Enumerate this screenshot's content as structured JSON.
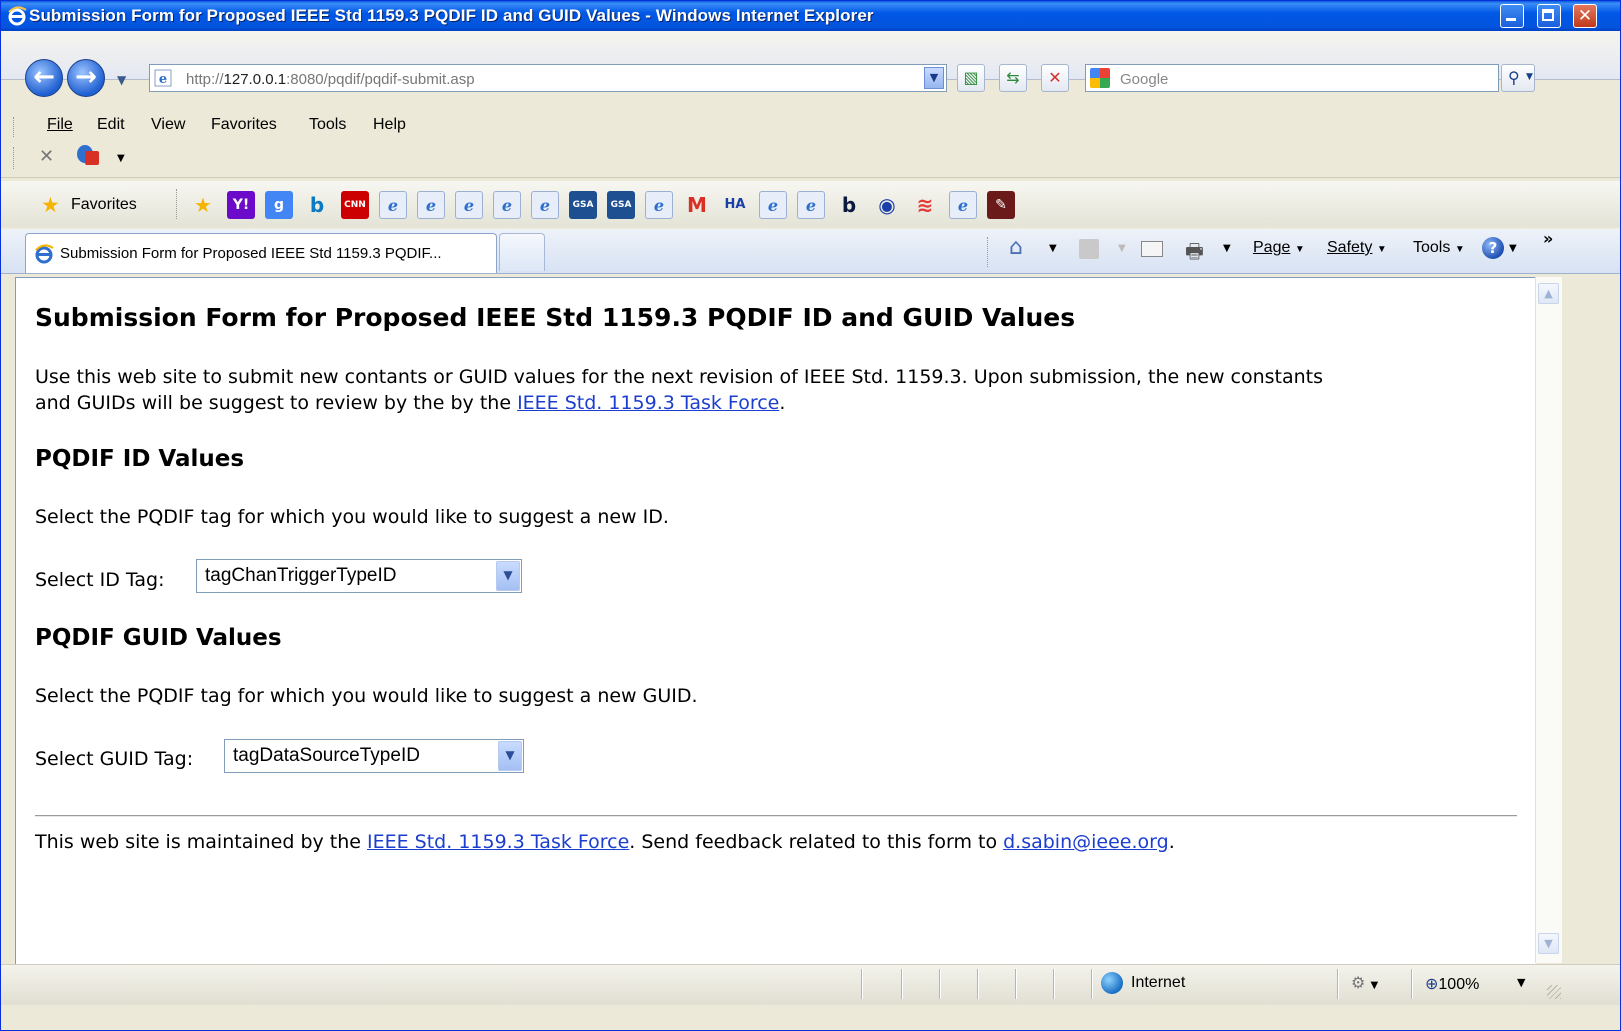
{
  "window": {
    "title": "Submission Form for Proposed IEEE Std 1159.3 PQDIF ID and GUID Values - Windows Internet Explorer"
  },
  "address": {
    "url_prefix": "http://",
    "url_host": "127.0.0.1",
    "url_rest": ":8080/pqdif/pqdif-submit.asp"
  },
  "search": {
    "placeholder": "Google"
  },
  "menu": {
    "file": "File",
    "edit": "Edit",
    "view": "View",
    "favorites": "Favorites",
    "tools": "Tools",
    "help": "Help"
  },
  "favorites_bar": {
    "label": "Favorites",
    "icons": [
      {
        "name": "add-favorite-icon",
        "text": "★",
        "color": "#f4b400"
      },
      {
        "name": "yahoo-icon",
        "text": "Y!",
        "color": "#6b0ac9"
      },
      {
        "name": "google-icon",
        "text": "g",
        "color": "#4285f4"
      },
      {
        "name": "bing-icon",
        "text": "b",
        "color": "#0a7ac4"
      },
      {
        "name": "cnn-icon",
        "text": "CNN",
        "color": "#cc0000"
      },
      {
        "name": "ie-page-icon",
        "text": "e",
        "color": "#2f6fce"
      },
      {
        "name": "ie-page-icon",
        "text": "e",
        "color": "#2f6fce"
      },
      {
        "name": "ie-page-icon",
        "text": "e",
        "color": "#2f6fce"
      },
      {
        "name": "ie-page-icon",
        "text": "e",
        "color": "#2f6fce"
      },
      {
        "name": "ie-page-icon",
        "text": "e",
        "color": "#2f6fce"
      },
      {
        "name": "gsa-icon",
        "text": "GSA",
        "color": "#1d4f91"
      },
      {
        "name": "gsa-icon",
        "text": "GSA",
        "color": "#1d4f91"
      },
      {
        "name": "ie-page-icon",
        "text": "e",
        "color": "#2f6fce"
      },
      {
        "name": "gmail-icon",
        "text": "M",
        "color": "#d93025"
      },
      {
        "name": "ha-icon",
        "text": "HA",
        "color": "#1a3fa8"
      },
      {
        "name": "ie-page-icon",
        "text": "e",
        "color": "#2f6fce"
      },
      {
        "name": "ie-page-icon",
        "text": "e",
        "color": "#2f6fce"
      },
      {
        "name": "b-circle-icon",
        "text": "b",
        "color": "#0d1b3e"
      },
      {
        "name": "globe-icon",
        "text": "◉",
        "color": "#1a3fa8"
      },
      {
        "name": "signal-icon",
        "text": "≋",
        "color": "#e53935"
      },
      {
        "name": "ie-page-icon",
        "text": "e",
        "color": "#2f6fce"
      },
      {
        "name": "bookmark-red-icon",
        "text": "✎",
        "color": "#6b1a1a"
      }
    ]
  },
  "tab": {
    "title": "Submission Form for Proposed IEEE Std 1159.3 PQDIF..."
  },
  "command_bar": {
    "page": "Page",
    "safety": "Safety",
    "tools": "Tools"
  },
  "page": {
    "heading": "Submission Form for Proposed IEEE Std 1159.3 PQDIF ID and GUID Values",
    "intro_line1": "Use this web site to submit new contants or GUID values for the next revision of IEEE Std. 1159.3. Upon submission, the new constants",
    "intro_line2_before": "and GUIDs will be suggest to review by the by the ",
    "intro_link": "IEEE Std. 1159.3 Task Force",
    "intro_line2_after": ".",
    "id_section_heading": "PQDIF ID Values",
    "id_section_text": "Select the PQDIF tag for which you would like to suggest a new ID.",
    "id_select_label": "Select ID Tag:",
    "id_select_value": "tagChanTriggerTypeID",
    "guid_section_heading": "PQDIF GUID Values",
    "guid_section_text": "Select the PQDIF tag for which you would like to suggest a new GUID.",
    "guid_select_label": "Select GUID Tag:",
    "guid_select_value": "tagDataSourceTypeID",
    "footer_before": "This web site is maintained by the ",
    "footer_link": "IEEE Std. 1159.3 Task Force",
    "footer_middle": ". Send feedback related to this form to ",
    "footer_email": "d.sabin@ieee.org",
    "footer_after": "."
  },
  "status": {
    "zone": "Internet",
    "zoom": "100%"
  }
}
